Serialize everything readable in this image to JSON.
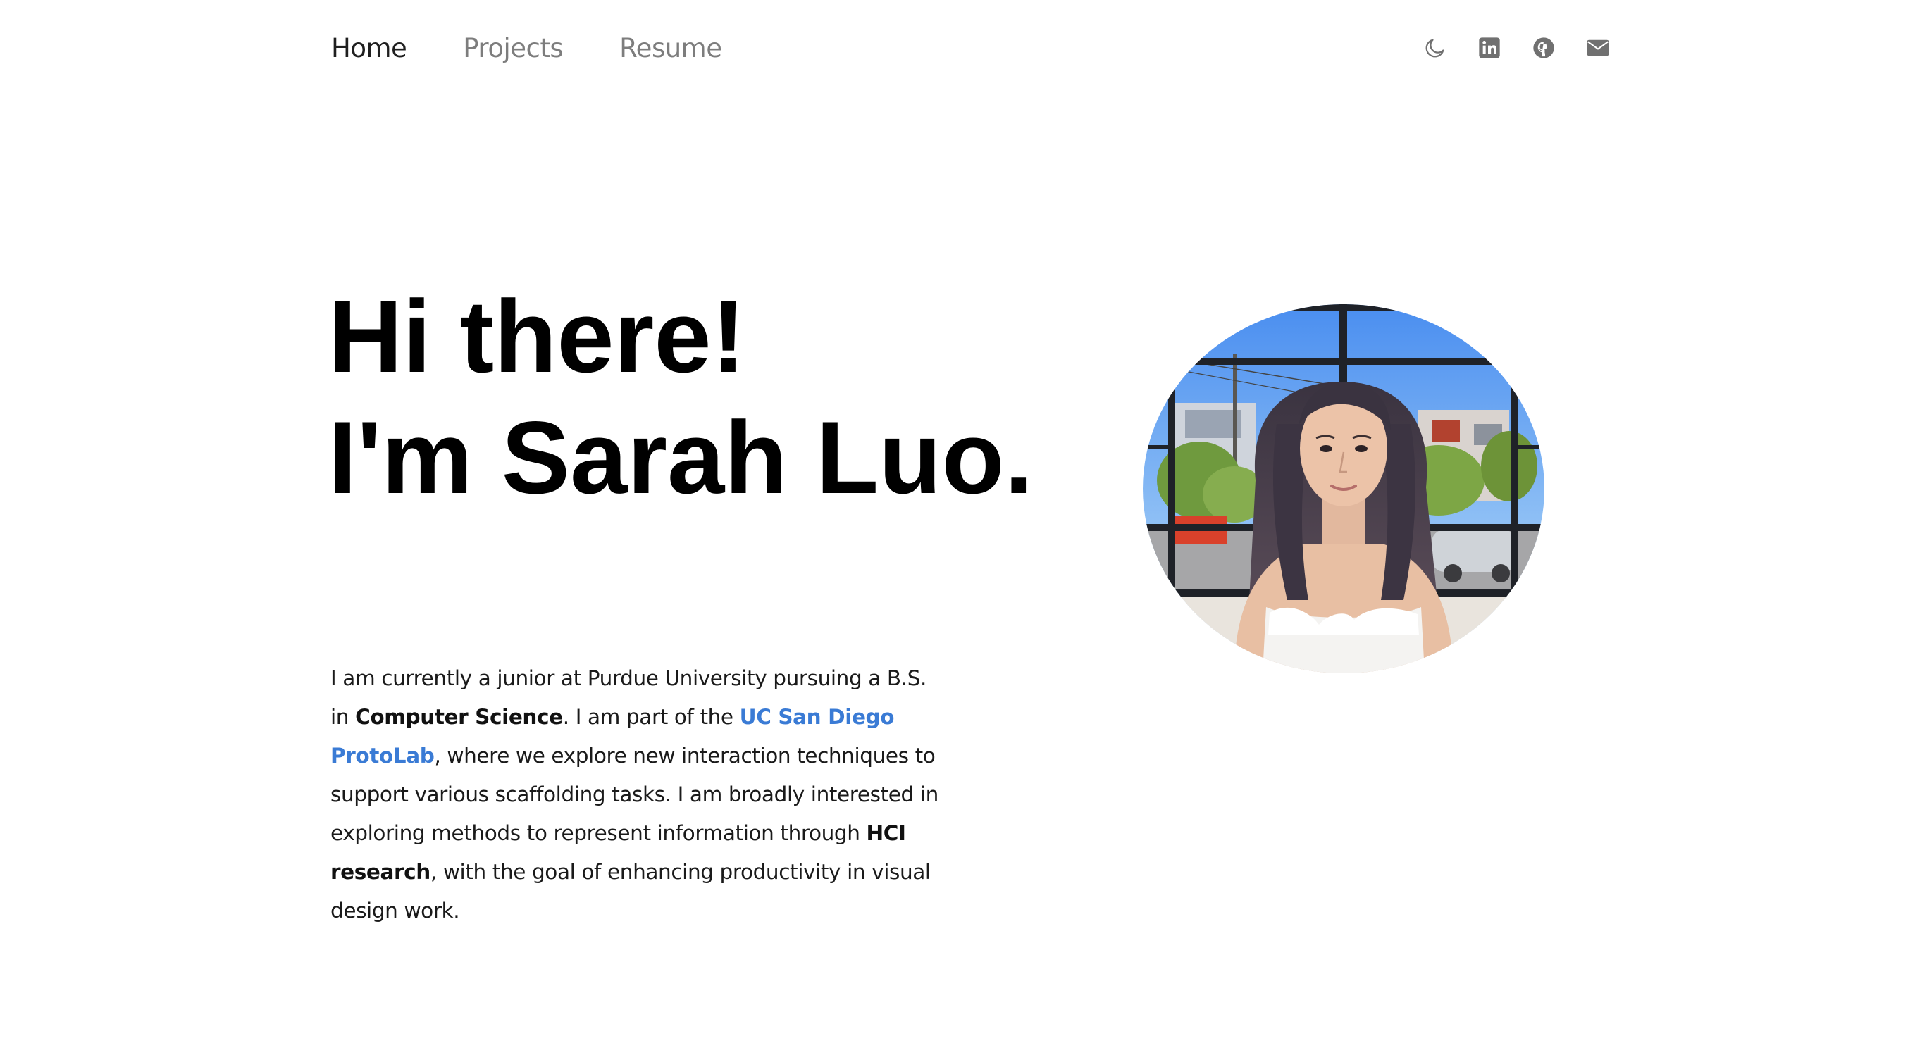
{
  "nav": {
    "links": [
      {
        "label": "Home",
        "active": true
      },
      {
        "label": "Projects",
        "active": false
      },
      {
        "label": "Resume",
        "active": false
      }
    ],
    "icons": [
      "moon-icon",
      "linkedin-icon",
      "github-icon",
      "mail-icon"
    ]
  },
  "hero": {
    "line1": "Hi there!",
    "line2": "I'm Sarah Luo."
  },
  "bio": {
    "part1": "I am currently a junior at Purdue University pursuing a B.S. in ",
    "major": "Computer Science",
    "part2": ". I am part of the ",
    "lab_link": "UC San Diego ProtoLab",
    "part3": ", where we explore new interaction techniques to support various scaffolding tasks. I am broadly interested in exploring methods to represent information through ",
    "research": "HCI research",
    "part4": ", with the goal of enhancing productivity in visual design work."
  },
  "colors": {
    "link": "#3a7bd5",
    "nav_inactive": "#7d7d7d",
    "nav_active": "#1f1f1f",
    "icon": "#707070"
  },
  "portrait": {
    "icon": "profile-photo"
  }
}
